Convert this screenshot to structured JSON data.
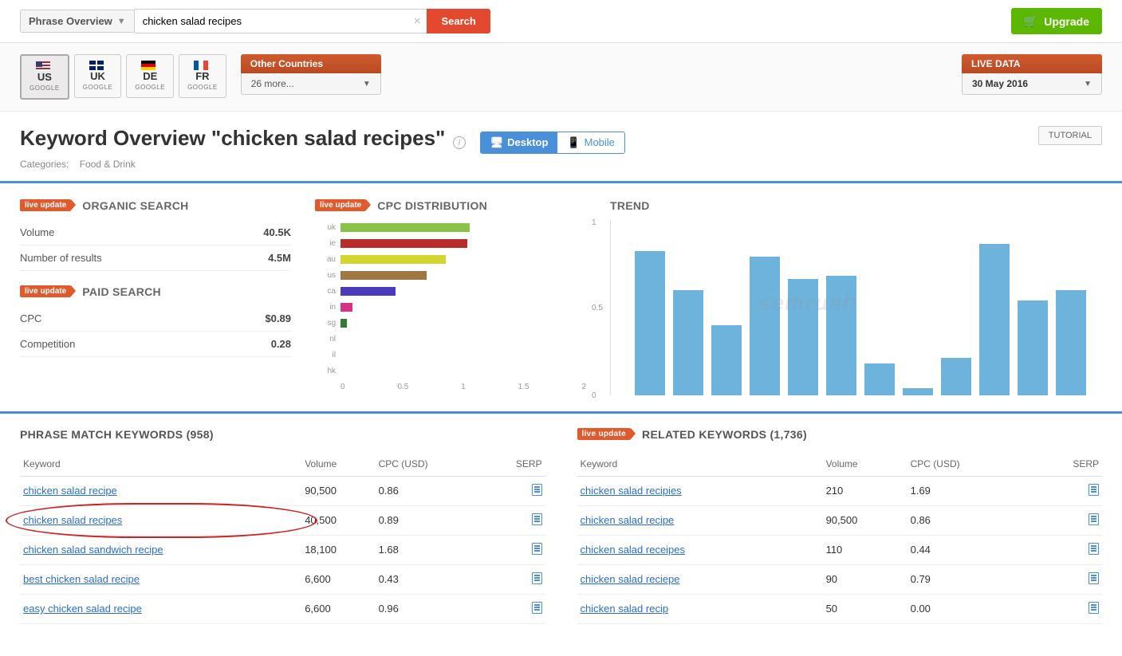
{
  "topbar": {
    "dropdown_label": "Phrase Overview",
    "search_value": "chicken salad recipes",
    "search_button": "Search",
    "upgrade_button": "Upgrade"
  },
  "countries": [
    {
      "code": "US",
      "sub": "GOOGLE",
      "flag": "us",
      "active": true
    },
    {
      "code": "UK",
      "sub": "GOOGLE",
      "flag": "uk",
      "active": false
    },
    {
      "code": "DE",
      "sub": "GOOGLE",
      "flag": "de",
      "active": false
    },
    {
      "code": "FR",
      "sub": "GOOGLE",
      "flag": "fr",
      "active": false
    }
  ],
  "other_countries": {
    "header": "Other Countries",
    "body": "26 more..."
  },
  "live_data": {
    "header": "LIVE DATA",
    "body": "30 May 2016"
  },
  "title": {
    "heading": "Keyword Overview \"chicken salad recipes\"",
    "categories_label": "Categories:",
    "categories_value": "Food & Drink",
    "device_desktop": "Desktop",
    "device_mobile": "Mobile",
    "tutorial": "TUTORIAL"
  },
  "live_badge": "live update",
  "organic": {
    "title": "ORGANIC SEARCH",
    "rows": [
      {
        "label": "Volume",
        "value": "40.5K"
      },
      {
        "label": "Number of results",
        "value": "4.5M"
      }
    ]
  },
  "paid": {
    "title": "PAID SEARCH",
    "rows": [
      {
        "label": "CPC",
        "value": "$0.89"
      },
      {
        "label": "Competition",
        "value": "0.28"
      }
    ]
  },
  "cpc_dist": {
    "title": "CPC DISTRIBUTION",
    "axis": [
      "0",
      "0.5",
      "1",
      "1.5",
      "2"
    ]
  },
  "trend": {
    "title": "TREND"
  },
  "chart_data": [
    {
      "type": "bar",
      "orientation": "horizontal",
      "title": "CPC DISTRIBUTION",
      "categories": [
        "uk",
        "ie",
        "au",
        "us",
        "ca",
        "in",
        "sg",
        "nl",
        "il",
        "hk"
      ],
      "values": [
        1.05,
        1.03,
        0.86,
        0.7,
        0.45,
        0.1,
        0.05,
        0.0,
        0.0,
        0.0
      ],
      "colors": [
        "#8bc34a",
        "#b82c2c",
        "#d4d630",
        "#a07844",
        "#4a3bbd",
        "#d63384",
        "#2e7d32",
        "#888",
        "#888",
        "#888"
      ],
      "xlim": [
        0,
        2
      ],
      "xlabel": "",
      "ylabel": ""
    },
    {
      "type": "bar",
      "title": "TREND",
      "categories": [
        "1",
        "2",
        "3",
        "4",
        "5",
        "6",
        "7",
        "8",
        "9",
        "10",
        "11",
        "12"
      ],
      "values": [
        0.82,
        0.6,
        0.4,
        0.79,
        0.66,
        0.68,
        0.18,
        0.04,
        0.21,
        0.86,
        0.54,
        0.6
      ],
      "color": "#6db3dc",
      "ylim": [
        0,
        1
      ],
      "yticks": [
        0,
        0.5,
        1
      ]
    }
  ],
  "phrase_match": {
    "title": "PHRASE MATCH KEYWORDS",
    "count": "(958)",
    "cols": [
      "Keyword",
      "Volume",
      "CPC (USD)",
      "SERP"
    ],
    "rows": [
      {
        "kw": "chicken salad recipe",
        "vol": "90,500",
        "cpc": "0.86",
        "circled": false
      },
      {
        "kw": "chicken salad recipes",
        "vol": "40,500",
        "cpc": "0.89",
        "circled": true
      },
      {
        "kw": "chicken salad sandwich recipe",
        "vol": "18,100",
        "cpc": "1.68",
        "circled": false
      },
      {
        "kw": "best chicken salad recipe",
        "vol": "6,600",
        "cpc": "0.43",
        "circled": false
      },
      {
        "kw": "easy chicken salad recipe",
        "vol": "6,600",
        "cpc": "0.96",
        "circled": false
      }
    ]
  },
  "related": {
    "title": "RELATED KEYWORDS",
    "count": "(1,736)",
    "cols": [
      "Keyword",
      "Volume",
      "CPC (USD)",
      "SERP"
    ],
    "rows": [
      {
        "kw": "chicken salad recipies",
        "vol": "210",
        "cpc": "1.69"
      },
      {
        "kw": "chicken salad recipe",
        "vol": "90,500",
        "cpc": "0.86"
      },
      {
        "kw": "chicken salad receipes",
        "vol": "110",
        "cpc": "0.44"
      },
      {
        "kw": "chicken salad reciepe",
        "vol": "90",
        "cpc": "0.79"
      },
      {
        "kw": "chicken salad recip",
        "vol": "50",
        "cpc": "0.00"
      }
    ]
  }
}
